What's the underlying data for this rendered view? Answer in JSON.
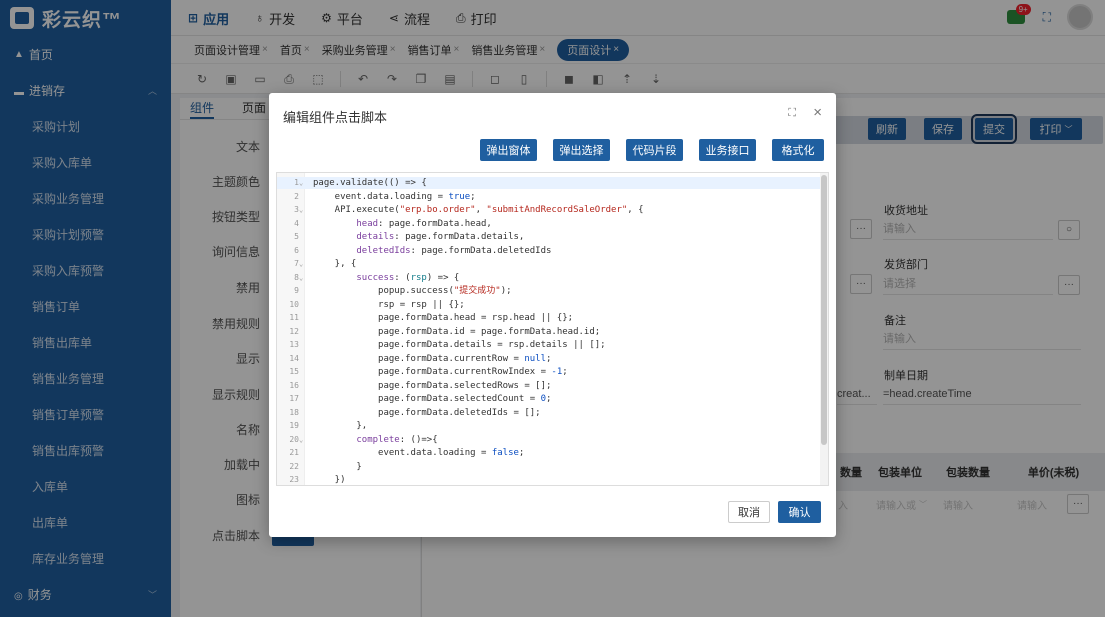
{
  "app": {
    "logo_text": "彩云织™",
    "badge": "9+"
  },
  "topnav": [
    {
      "icon": "⊞",
      "label": "应用",
      "active": true
    },
    {
      "icon": "♁",
      "label": "开发",
      "active": false
    },
    {
      "icon": "⚙",
      "label": "平台",
      "active": false
    },
    {
      "icon": "⋖",
      "label": "流程",
      "active": false
    },
    {
      "icon": "⎙",
      "label": "打印",
      "active": false
    }
  ],
  "sidebar": {
    "home": "首页",
    "group_jxc": "进销存",
    "items": [
      "采购计划",
      "采购入库单",
      "采购业务管理",
      "采购计划预警",
      "采购入库预警",
      "销售订单",
      "销售出库单",
      "销售业务管理",
      "销售订单预警",
      "销售出库预警",
      "入库单",
      "出库单",
      "库存业务管理"
    ],
    "group_finance": "财务"
  },
  "tabs": [
    {
      "label": "页面设计管理",
      "active": false
    },
    {
      "label": "首页",
      "active": false
    },
    {
      "label": "采购业务管理",
      "active": false
    },
    {
      "label": "销售订单",
      "active": false
    },
    {
      "label": "销售业务管理",
      "active": false
    },
    {
      "label": "页面设计",
      "active": true
    }
  ],
  "left_panel": {
    "tab_component": "组件",
    "tab_page": "页面",
    "props": [
      "文本",
      "主题颜色",
      "按钮类型",
      "询问信息",
      "禁用",
      "禁用规则",
      "显示",
      "显示规则",
      "名称",
      "加载中",
      "图标",
      "点击脚本"
    ]
  },
  "canvas": {
    "buttons": [
      "刷新",
      "保存",
      "提交",
      "打印"
    ],
    "fields": {
      "address_label": "收货地址",
      "address_placeholder": "请输入",
      "dept_label": "发货部门",
      "dept_placeholder": "请选择",
      "note_label": "备注",
      "note_placeholder": "请输入",
      "date_label": "制单日期",
      "date_value": "=head.createTime",
      "truncated_value": "creat..."
    },
    "grid_headers": [
      "数量",
      "包装单位",
      "包装数量",
      "单价(未税)"
    ],
    "grid_cells": [
      "入",
      "请输入或",
      "请输入",
      "请输入"
    ]
  },
  "modal": {
    "title": "编辑组件点击脚本",
    "buttons": [
      "弹出窗体",
      "弹出选择",
      "代码片段",
      "业务接口",
      "格式化"
    ],
    "cancel": "取消",
    "confirm": "确认",
    "code_lines": [
      "page.validate(() => {",
      "    event.data.loading = true;",
      "    API.execute(\"erp.bo.order\", \"submitAndRecordSaleOrder\", {",
      "        head: page.formData.head,",
      "        details: page.formData.details,",
      "        deletedIds: page.formData.deletedIds",
      "    }, {",
      "        success: (rsp) => {",
      "            popup.success(\"提交成功\");",
      "            rsp = rsp || {};",
      "            page.formData.head = rsp.head || {};",
      "            page.formData.id = page.formData.head.id;",
      "            page.formData.details = rsp.details || [];",
      "            page.formData.currentRow = null;",
      "            page.formData.currentRowIndex = -1;",
      "            page.formData.selectedRows = [];",
      "            page.formData.selectedCount = 0;",
      "            page.formData.deletedIds = [];",
      "        },",
      "        complete: ()=>{",
      "            event.data.loading = false;",
      "        }",
      "    })"
    ],
    "line_numbers": [
      "1",
      "2",
      "3",
      "4",
      "5",
      "6",
      "7",
      "8",
      "9",
      "10",
      "11",
      "12",
      "13",
      "14",
      "15",
      "16",
      "17",
      "18",
      "19",
      "20",
      "21",
      "22",
      "23"
    ]
  }
}
